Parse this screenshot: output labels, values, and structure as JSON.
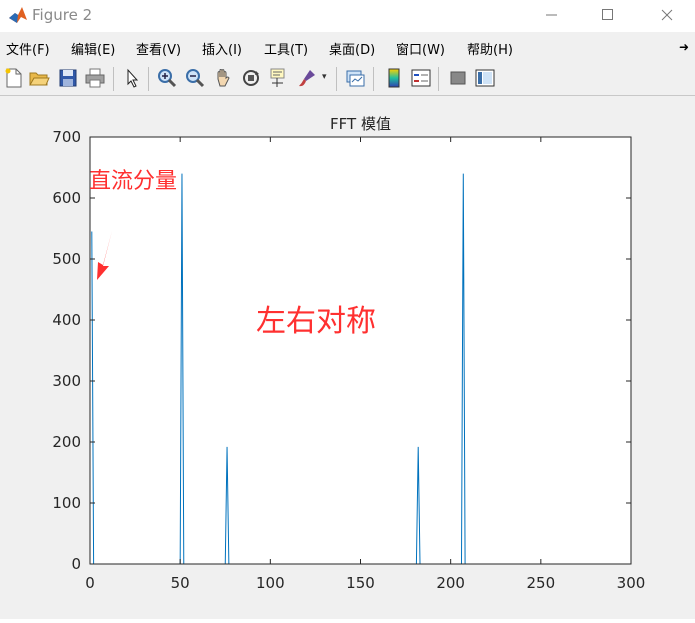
{
  "window": {
    "title": "Figure 2",
    "app_icon": "matlab-logo-icon",
    "controls": [
      "minimize-icon",
      "maximize-icon",
      "close-icon"
    ]
  },
  "menu": {
    "items": [
      "文件(F)",
      "编辑(E)",
      "查看(V)",
      "插入(I)",
      "工具(T)",
      "桌面(D)",
      "窗口(W)",
      "帮助(H)"
    ]
  },
  "toolbar": {
    "icons": [
      "new-figure-icon",
      "open-file-icon",
      "save-icon",
      "print-icon",
      "pointer-icon",
      "zoom-in-icon",
      "zoom-out-icon",
      "pan-hand-icon",
      "rotate-3d-icon",
      "data-cursor-icon",
      "brush-icon",
      "link-plot-icon",
      "colorbar-icon",
      "legend-icon",
      "hide-plot-tools-icon",
      "show-plot-tools-icon"
    ]
  },
  "annotations": {
    "dc_label": "直流分量",
    "dc_color": "#ff3030",
    "symmetry_label": "左右对称"
  },
  "chart_data": {
    "type": "line",
    "title": "FFT 模值",
    "xlabel": "",
    "ylabel": "",
    "xlim": [
      0,
      300
    ],
    "ylim": [
      0,
      700
    ],
    "xticks": [
      0,
      50,
      100,
      150,
      200,
      250,
      300
    ],
    "yticks": [
      0,
      100,
      200,
      300,
      400,
      500,
      600,
      700
    ],
    "line_color": "#0072bd",
    "series": [
      {
        "x": [
          1,
          2,
          3,
          50,
          51,
          52,
          75,
          76,
          77,
          181,
          182,
          183,
          206,
          207,
          208,
          256
        ],
        "y": [
          545,
          0,
          0,
          0,
          640,
          0,
          0,
          192,
          0,
          0,
          192,
          0,
          0,
          640,
          0,
          0
        ]
      }
    ]
  }
}
